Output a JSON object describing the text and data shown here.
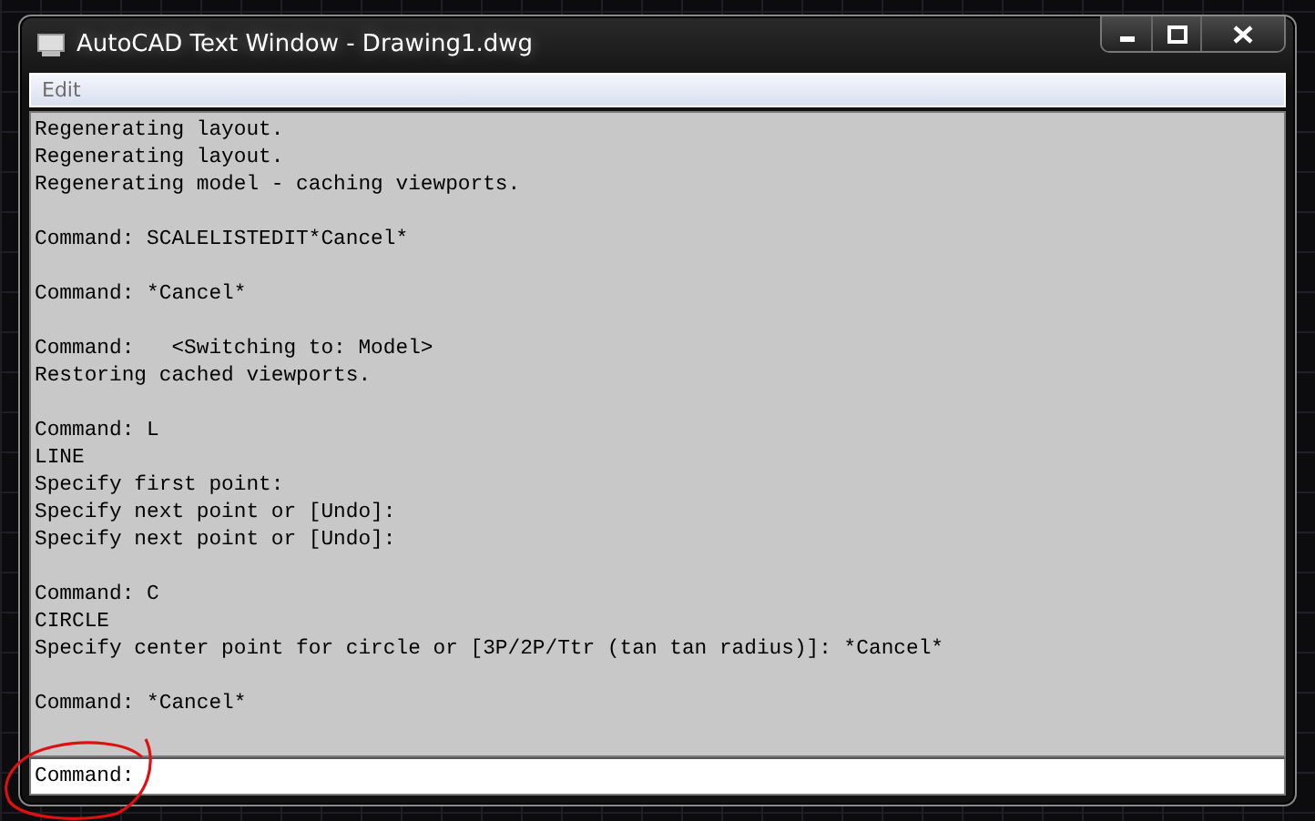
{
  "window": {
    "title": "AutoCAD Text Window - Drawing1.dwg"
  },
  "menu": [
    "Edit"
  ],
  "history": [
    [
      "Regenerating layout.",
      "Regenerating layout.",
      "Regenerating model - caching viewports."
    ],
    [
      "Command: SCALELISTEDIT*Cancel*"
    ],
    [
      "Command: *Cancel*"
    ],
    [
      "Command:   <Switching to: Model>",
      "Restoring cached viewports."
    ],
    [
      "Command: L",
      "LINE",
      "Specify first point:",
      "Specify next point or [Undo]:",
      "Specify next point or [Undo]:"
    ],
    [
      "Command: C",
      "CIRCLE",
      "Specify center point for circle or [3P/2P/Ttr (tan tan radius)]: *Cancel*"
    ],
    [
      "Command: *Cancel*"
    ]
  ],
  "command_line": {
    "prompt": "Command:"
  }
}
